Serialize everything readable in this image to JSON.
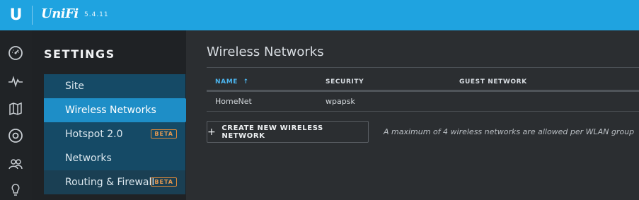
{
  "topbar": {
    "logo_letter": "U",
    "brand": "UniFi",
    "version": "5.4.11"
  },
  "iconbar": {
    "icons": [
      "dashboard-icon",
      "statistics-icon",
      "map-icon",
      "devices-icon",
      "clients-icon",
      "insights-icon"
    ]
  },
  "settings": {
    "title": "SETTINGS",
    "items": [
      {
        "label": "Site",
        "badge": "",
        "active": false
      },
      {
        "label": "Wireless Networks",
        "badge": "",
        "active": true
      },
      {
        "label": "Hotspot 2.0",
        "badge": "BETA",
        "active": false
      },
      {
        "label": "Networks",
        "badge": "",
        "active": false
      },
      {
        "label": "Routing & Firewall",
        "badge": "BETA",
        "active": false
      }
    ]
  },
  "main": {
    "title": "Wireless Networks",
    "table": {
      "columns": [
        "NAME",
        "SECURITY",
        "GUEST NETWORK"
      ],
      "sort_indicator": "↑",
      "rows": [
        [
          "HomeNet",
          "wpapsk",
          ""
        ]
      ]
    },
    "create_button": "CREATE NEW WIRELESS NETWORK",
    "create_plus": "+",
    "limit_note": "A maximum of 4 wireless networks are allowed per WLAN group"
  },
  "colors": {
    "accent": "#1fa3e0",
    "active_item": "#1e8ec7",
    "menu_item": "#154a66",
    "beta": "#e08a3a"
  }
}
